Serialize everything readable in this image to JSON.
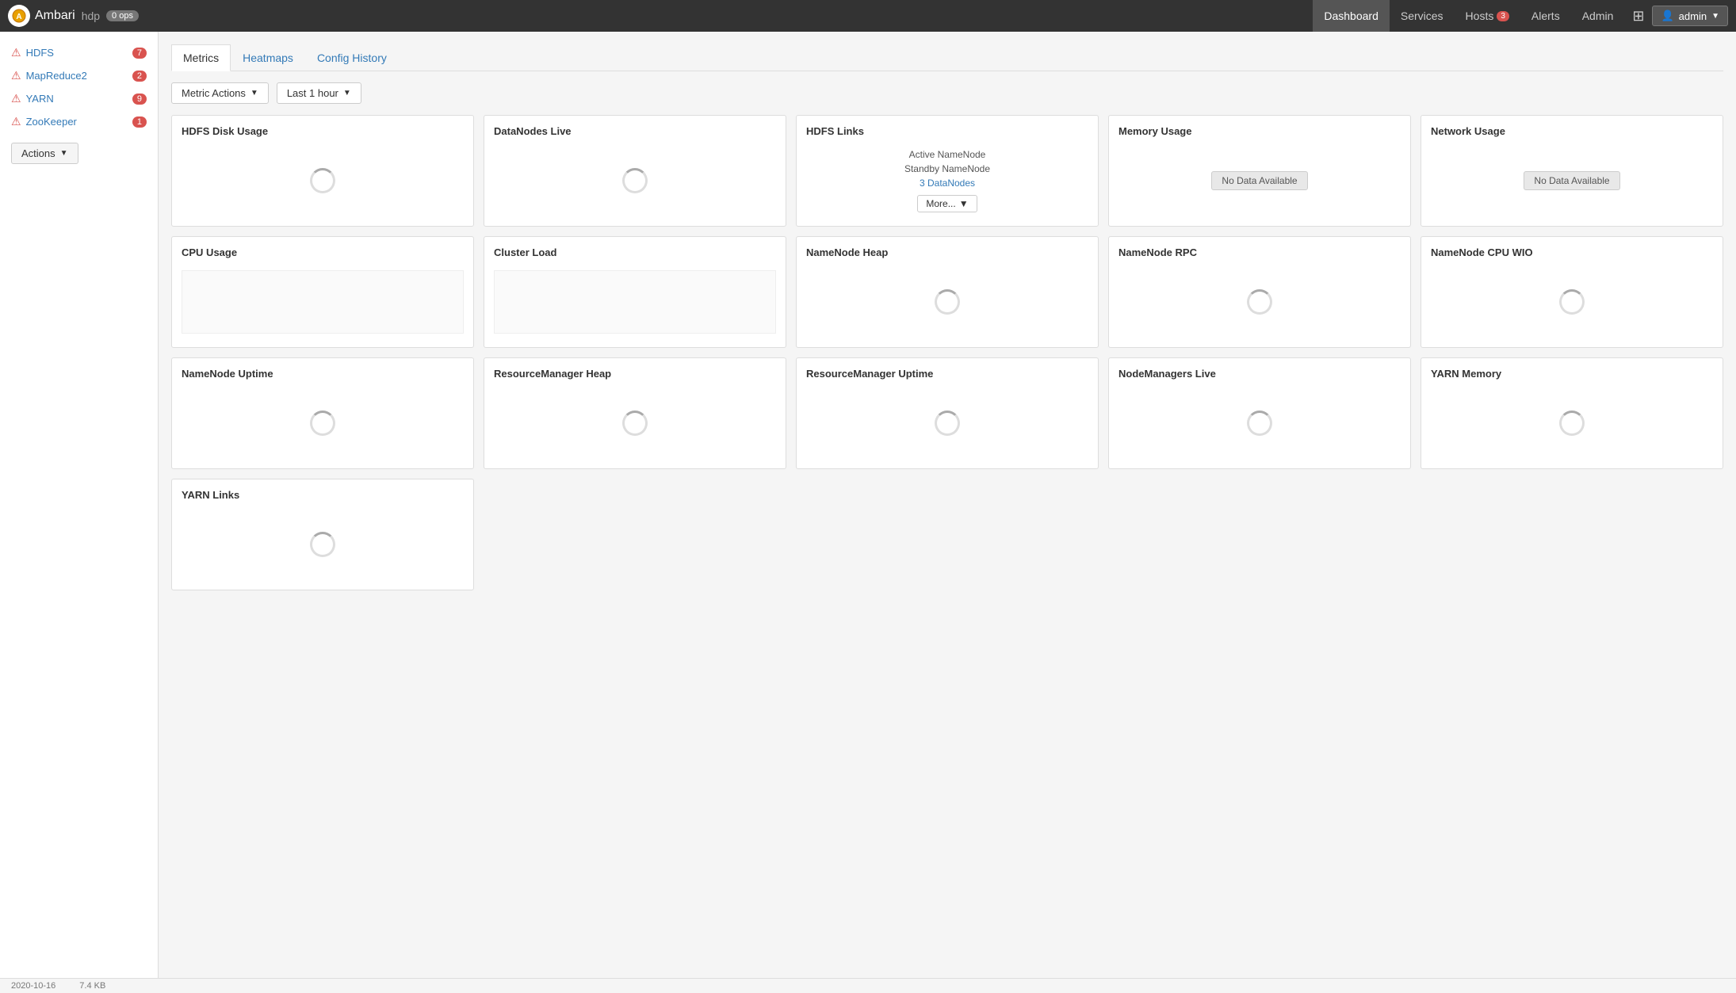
{
  "topnav": {
    "logo_text": "A",
    "app_name": "Ambari",
    "cluster_name": "hdp",
    "ops_badge": "0 ops",
    "links": [
      {
        "label": "Dashboard",
        "active": true,
        "badge": null
      },
      {
        "label": "Services",
        "active": false,
        "badge": null
      },
      {
        "label": "Hosts",
        "active": false,
        "badge": "3"
      },
      {
        "label": "Alerts",
        "active": false,
        "badge": null
      },
      {
        "label": "Admin",
        "active": false,
        "badge": null
      }
    ],
    "admin_label": "admin"
  },
  "sidebar": {
    "items": [
      {
        "label": "HDFS",
        "badge": "7"
      },
      {
        "label": "MapReduce2",
        "badge": "2"
      },
      {
        "label": "YARN",
        "badge": "9"
      },
      {
        "label": "ZooKeeper",
        "badge": "1"
      }
    ],
    "actions_label": "Actions"
  },
  "tabs": [
    {
      "label": "Metrics",
      "active": true
    },
    {
      "label": "Heatmaps",
      "active": false
    },
    {
      "label": "Config History",
      "active": false
    }
  ],
  "toolbar": {
    "metric_actions_label": "Metric Actions",
    "time_range_label": "Last 1 hour"
  },
  "metrics": [
    {
      "id": "hdfs-disk-usage",
      "title": "HDFS Disk Usage",
      "type": "spinner"
    },
    {
      "id": "datanodes-live",
      "title": "DataNodes Live",
      "type": "spinner"
    },
    {
      "id": "hdfs-links",
      "title": "HDFS Links",
      "type": "links",
      "links": [
        {
          "label": "Active NameNode",
          "href": "#"
        },
        {
          "label": "Standby NameNode",
          "href": "#"
        },
        {
          "label": "3 DataNodes",
          "href": "#",
          "highlight": true
        }
      ],
      "more_label": "More..."
    },
    {
      "id": "memory-usage",
      "title": "Memory Usage",
      "type": "nodata",
      "no_data_label": "No Data Available"
    },
    {
      "id": "network-usage",
      "title": "Network Usage",
      "type": "nodata",
      "no_data_label": "No Data Available"
    },
    {
      "id": "cpu-usage",
      "title": "CPU Usage",
      "type": "chart"
    },
    {
      "id": "cluster-load",
      "title": "Cluster Load",
      "type": "chart"
    },
    {
      "id": "namenode-heap",
      "title": "NameNode Heap",
      "type": "spinner"
    },
    {
      "id": "namenode-rpc",
      "title": "NameNode RPC",
      "type": "spinner"
    },
    {
      "id": "namenode-cpu-wio",
      "title": "NameNode CPU WIO",
      "type": "spinner"
    },
    {
      "id": "namenode-uptime",
      "title": "NameNode Uptime",
      "type": "spinner"
    },
    {
      "id": "resourcemanager-heap",
      "title": "ResourceManager Heap",
      "type": "spinner"
    },
    {
      "id": "resourcemanager-uptime",
      "title": "ResourceManager Uptime",
      "type": "spinner"
    },
    {
      "id": "nodemanagers-live",
      "title": "NodeManagers Live",
      "type": "spinner"
    },
    {
      "id": "yarn-memory",
      "title": "YARN Memory",
      "type": "spinner"
    },
    {
      "id": "yarn-links",
      "title": "YARN Links",
      "type": "spinner"
    }
  ],
  "statusbar": {
    "date": "2020-10-16",
    "size": "7.4 KB"
  }
}
